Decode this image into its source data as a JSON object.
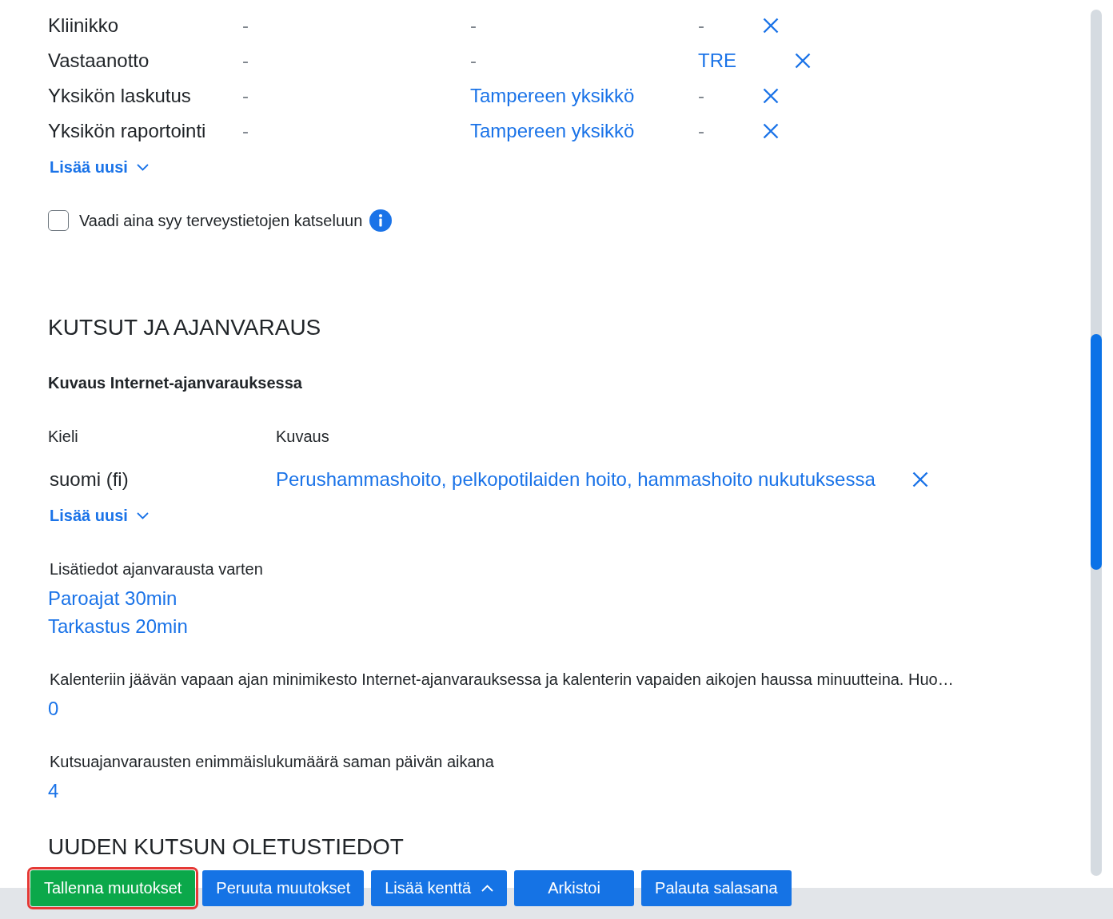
{
  "unit_rows": {
    "rows": [
      {
        "label": "Kliinikko",
        "cells": [
          {
            "text": "-",
            "empty": true
          },
          {
            "text": "-",
            "empty": true
          },
          {
            "text": "-",
            "empty": true
          }
        ]
      },
      {
        "label": "Vastaanotto",
        "cells": [
          {
            "text": "-",
            "empty": true
          },
          {
            "text": "-",
            "empty": true
          },
          {
            "text": "TRE",
            "empty": false
          }
        ]
      },
      {
        "label": "Yksikön laskutus",
        "cells": [
          {
            "text": "-",
            "empty": true
          },
          {
            "text": "Tampereen yksikkö",
            "empty": false
          },
          {
            "text": "-",
            "empty": true
          }
        ]
      },
      {
        "label": "Yksikön raportointi",
        "cells": [
          {
            "text": "-",
            "empty": true
          },
          {
            "text": "Tampereen yksikkö",
            "empty": false
          },
          {
            "text": "-",
            "empty": true
          }
        ]
      }
    ],
    "add_link": {
      "label": "Lisää uusi"
    }
  },
  "require_reason": {
    "label": "Vaadi aina syy terveystietojen katseluun",
    "checked": false
  },
  "invitations_section": {
    "title": "KUTSUT JA AJANVARAUS",
    "description_table": {
      "title": "Kuvaus Internet-ajanvarauksessa",
      "columns": [
        "Kieli",
        "Kuvaus"
      ],
      "rows": [
        {
          "language": "suomi (fi)",
          "description": "Perushammashoito, pelkopotilaiden hoito, hammashoito nukutuksessa"
        }
      ],
      "add_link": {
        "label": "Lisää uusi"
      }
    },
    "fields": [
      {
        "label": "Lisätiedot ajanvarausta varten",
        "values": [
          "Paroajat 30min",
          "Tarkastus 20min"
        ]
      },
      {
        "label": "Kalenteriin jäävän vapaan ajan minimikesto Internet-ajanvarauksessa ja kalenterin vapaiden aikojen haussa minuutteina. Huo…",
        "values": [
          "0"
        ]
      },
      {
        "label": "Kutsuajanvarausten enimmäislukumäärä saman päivän aikana",
        "values": [
          "4"
        ]
      }
    ]
  },
  "new_invitation_defaults": {
    "title": "UUDEN KUTSUN OLETUSTIEDOT"
  },
  "buttons": [
    {
      "label": "Tallenna muutokset",
      "kind": "success",
      "highlighted": true
    },
    {
      "label": "Peruuta muutokset",
      "kind": "primary",
      "highlighted": false
    },
    {
      "label": "Lisää kenttä",
      "kind": "dropdown",
      "highlighted": false
    },
    {
      "label": "Arkistoi",
      "kind": "primary",
      "highlighted": false
    },
    {
      "label": "Palauta salasana",
      "kind": "primary",
      "highlighted": false
    }
  ]
}
